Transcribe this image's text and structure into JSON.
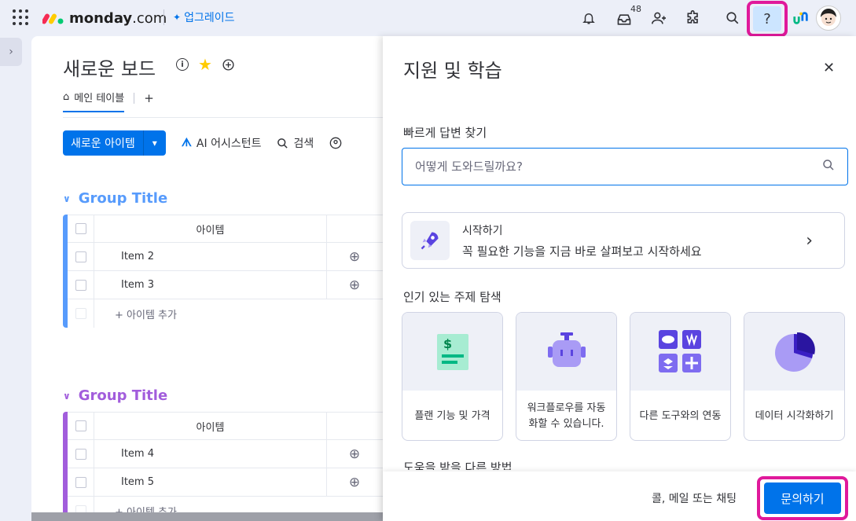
{
  "topbar": {
    "brand": "monday",
    "brand_suffix": ".com",
    "upgrade_label": "업그레이드",
    "inbox_count": "48",
    "help_label": "?"
  },
  "board": {
    "title": "새로운 보드",
    "tab_main": "메인 테이블",
    "tab_add": "+",
    "new_item": "새로운 아이템",
    "ai_assistant": "AI 어시스턴트",
    "search": "검색",
    "groups": [
      {
        "title": "Group Title",
        "color": "#579bfc",
        "column_header": "아이템",
        "items": [
          "Item 2",
          "Item 3"
        ],
        "add_item": "+ 아이템 추가"
      },
      {
        "title": "Group Title",
        "color": "#a25ddc",
        "column_header": "아이템",
        "items": [
          "Item 4",
          "Item 5"
        ],
        "add_item": "+ 아이템 추가"
      }
    ]
  },
  "help_panel": {
    "title": "지원 및 학습",
    "quick_answer_label": "빠르게 답변 찾기",
    "search_placeholder": "어떻게 도와드릴까요?",
    "start_title": "시작하기",
    "start_desc": "꼭 필요한 기능을 지금 바로 살펴보고 시작하세요",
    "popular_label": "인기 있는 주제 탐색",
    "topics": [
      {
        "label": "플랜 기능 및 가격",
        "icon": "dollar-document-icon"
      },
      {
        "label": "워크플로우를 자동화할 수 있습니다.",
        "icon": "robot-icon"
      },
      {
        "label": "다른 도구와의 연동",
        "icon": "integrations-icon"
      },
      {
        "label": "데이터 시각화하기",
        "icon": "pie-chart-icon"
      }
    ],
    "more_label": "도움을 받을 다른 방법",
    "footer_text": "콜, 메일 또는 채팅",
    "contact_button": "문의하기"
  },
  "colors": {
    "accent": "#0073ea",
    "highlight": "#e0199b"
  }
}
